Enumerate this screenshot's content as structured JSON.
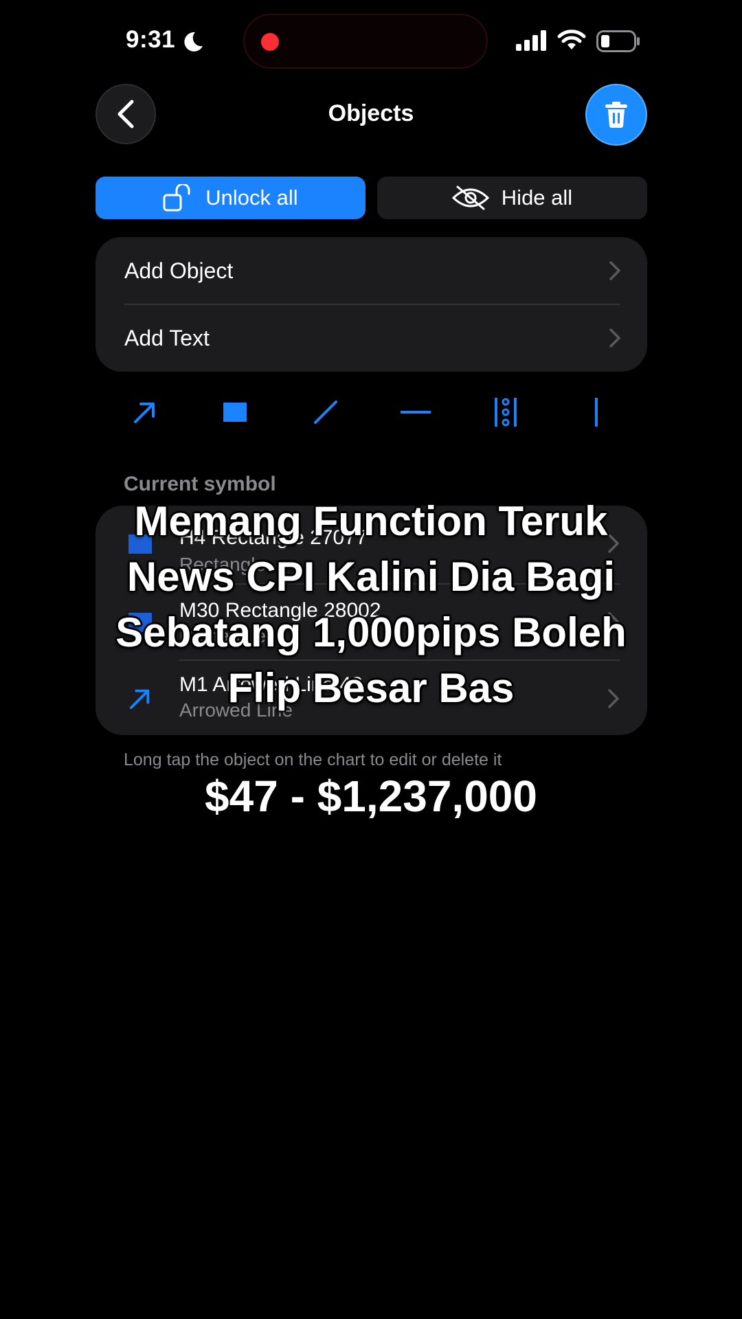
{
  "status_bar": {
    "time": "9:31"
  },
  "header": {
    "title": "Objects"
  },
  "toggles": {
    "unlock_all": "Unlock all",
    "hide_all": "Hide all"
  },
  "add_menu": {
    "add_object": "Add Object",
    "add_text": "Add Text"
  },
  "tools": [
    "arrow-icon",
    "rectangle-icon",
    "trend-line-icon",
    "horizontal-line-icon",
    "fibonacci-icon",
    "vertical-line-icon"
  ],
  "section": {
    "label": "Current symbol"
  },
  "objects": [
    {
      "title": "H4 Rectangle 27077",
      "subtitle": "Rectangle",
      "icon": "rectangle-icon"
    },
    {
      "title": "M30 Rectangle 28002",
      "subtitle": "Rectangle",
      "icon": "rectangle-icon"
    },
    {
      "title": "M1 Arrowed Line 43",
      "subtitle": "Arrowed Line",
      "icon": "arrow-icon"
    }
  ],
  "hint": "Long tap the object on the chart to edit or delete it",
  "overlay": {
    "caption_lines": [
      "Memang Function Teruk",
      "News CPI Kalini Dia Bagi",
      "Sebatang 1,000pips Boleh",
      "Flip Besar Bas"
    ],
    "price": "$47 - $1,237,000"
  },
  "colors": {
    "accent": "#1c83ff",
    "card": "#1c1c1e",
    "background": "#000000",
    "muted": "#8a8a8e",
    "record": "#ff2d36"
  }
}
